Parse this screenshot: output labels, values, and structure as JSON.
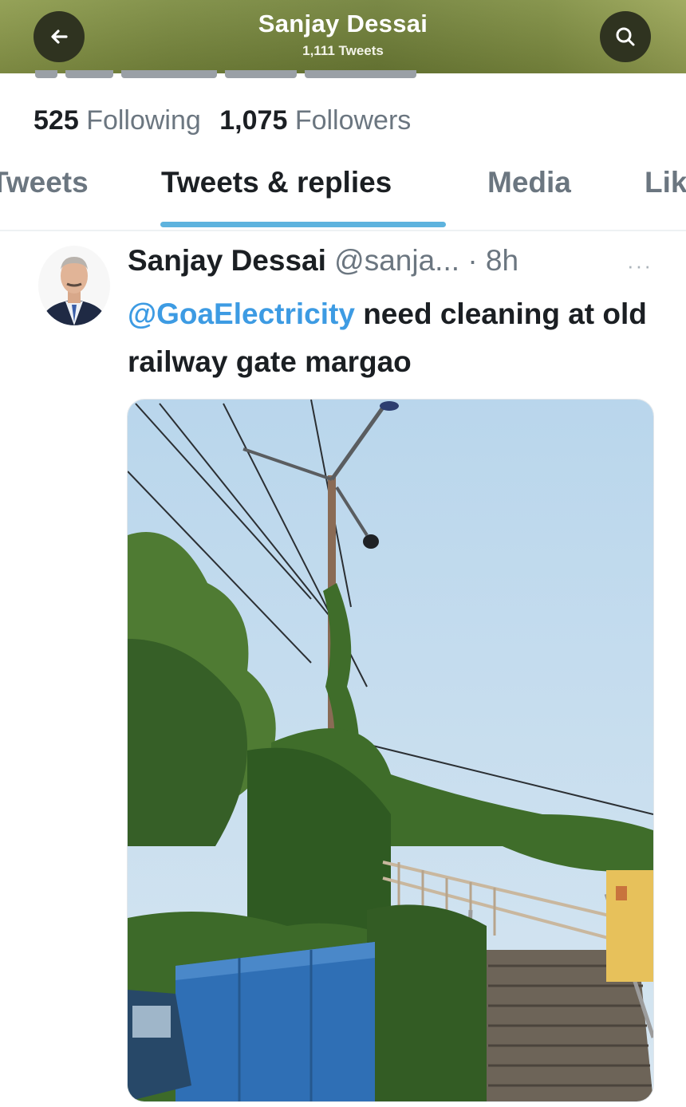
{
  "header": {
    "title": "Sanjay Dessai",
    "subtitle": "1,111 Tweets",
    "back_icon": "arrow-left-icon",
    "search_icon": "search-icon"
  },
  "stats": {
    "following_count": "525",
    "following_label": "Following",
    "followers_count": "1,075",
    "followers_label": "Followers"
  },
  "tabs": [
    {
      "label": "Tweets"
    },
    {
      "label": "Tweets & replies",
      "active": true
    },
    {
      "label": "Media"
    },
    {
      "label": "Lik"
    }
  ],
  "tweet": {
    "author_name": "Sanjay Dessai",
    "author_handle": "@sanja...",
    "time": "· 8h",
    "more_icon": "more-icon",
    "mention": "@GoaElectricity",
    "text": " need cleaning at old railway gate margao",
    "media_description": "photo"
  },
  "colors": {
    "accent": "#5eb3de",
    "mention": "#3d9be3",
    "secondary_text": "#6b7680",
    "header_bg": "#7a8a3e"
  }
}
